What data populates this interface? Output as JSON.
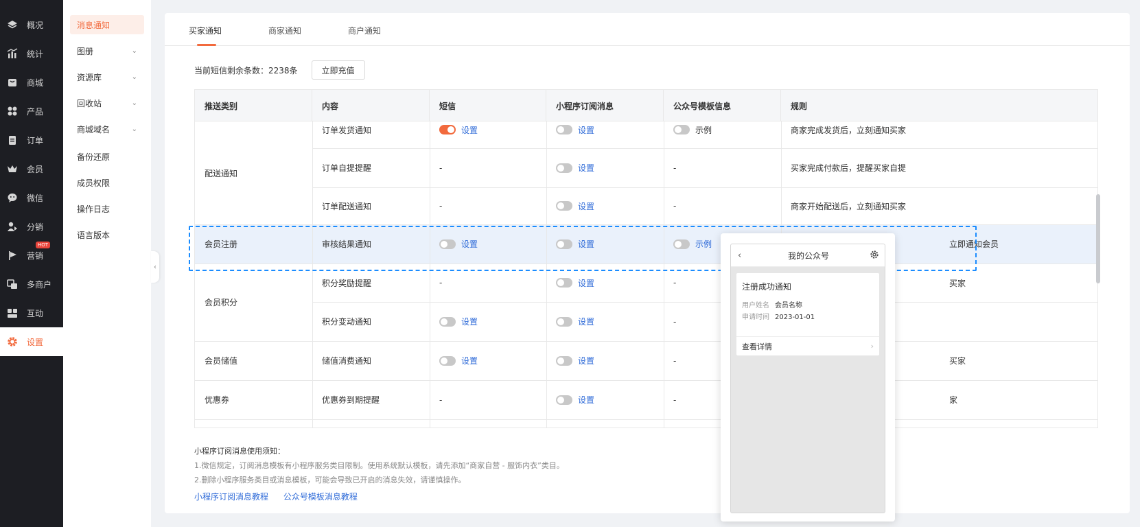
{
  "nav": {
    "items": [
      {
        "label": "概况",
        "icon": "layers-icon"
      },
      {
        "label": "统计",
        "icon": "chart-icon"
      },
      {
        "label": "商城",
        "icon": "shop-icon"
      },
      {
        "label": "产品",
        "icon": "product-icon"
      },
      {
        "label": "订单",
        "icon": "order-icon"
      },
      {
        "label": "会员",
        "icon": "crown-icon"
      },
      {
        "label": "微信",
        "icon": "wechat-icon"
      },
      {
        "label": "分销",
        "icon": "distribution-icon"
      },
      {
        "label": "营销",
        "icon": "flag-icon",
        "badge": "HOT"
      },
      {
        "label": "多商户",
        "icon": "merchant-icon"
      },
      {
        "label": "互动",
        "icon": "interact-icon"
      },
      {
        "label": "设置",
        "icon": "gear-icon",
        "active": true
      }
    ]
  },
  "submenu": {
    "items": [
      {
        "label": "消息通知",
        "active": true
      },
      {
        "label": "图册",
        "expandable": true
      },
      {
        "label": "资源库",
        "expandable": true
      },
      {
        "label": "回收站",
        "expandable": true
      },
      {
        "label": "商城域名",
        "expandable": true
      },
      {
        "label": "备份还原"
      },
      {
        "label": "成员权限"
      },
      {
        "label": "操作日志"
      },
      {
        "label": "语言版本"
      }
    ]
  },
  "tabs": [
    {
      "label": "买家通知",
      "active": true
    },
    {
      "label": "商家通知"
    },
    {
      "label": "商户通知"
    }
  ],
  "sms": {
    "remaining_label": "当前短信剩余条数：2238条",
    "recharge_button": "立即充值"
  },
  "table": {
    "headers": [
      "推送类别",
      "内容",
      "短信",
      "小程序订阅消息",
      "公众号模板信息",
      "规则"
    ],
    "groups": [
      "配送通知",
      "会员注册",
      "会员积分",
      "会员储值",
      "优惠券"
    ],
    "rows": [
      {
        "content": "订单发货通知",
        "sms": {
          "toggle": "on",
          "text": "设置"
        },
        "mini": {
          "toggle": "off",
          "text": "设置"
        },
        "mp": {
          "toggle": "off",
          "text": "示例"
        },
        "rule": "商家完成发货后，立刻通知买家"
      },
      {
        "content": "订单自提提醒",
        "sms": {
          "text": "-"
        },
        "mini": {
          "toggle": "off",
          "text": "设置"
        },
        "mp": {
          "text": "-"
        },
        "rule": "买家完成付款后，提醒买家自提"
      },
      {
        "content": "订单配送通知",
        "sms": {
          "text": "-"
        },
        "mini": {
          "toggle": "off",
          "text": "设置"
        },
        "mp": {
          "text": "-"
        },
        "rule": "商家开始配送后，立刻通知买家"
      },
      {
        "content": "审核结果通知",
        "sms": {
          "toggle": "off",
          "text": "设置"
        },
        "mini": {
          "toggle": "off",
          "text": "设置"
        },
        "mp": {
          "toggle": "off",
          "text": "示例"
        },
        "rule": "立即通知会员"
      },
      {
        "content": "积分奖励提醒",
        "sms": {
          "text": "-"
        },
        "mini": {
          "toggle": "off",
          "text": "设置"
        },
        "mp": {
          "text": "-"
        },
        "rule": "买家"
      },
      {
        "content": "积分变动通知",
        "sms": {
          "toggle": "off",
          "text": "设置"
        },
        "mini": {
          "toggle": "off",
          "text": "设置"
        },
        "mp": {
          "text": "-"
        },
        "rule": ""
      },
      {
        "content": "储值消费通知",
        "sms": {
          "toggle": "off",
          "text": "设置"
        },
        "mini": {
          "toggle": "off",
          "text": "设置"
        },
        "mp": {
          "text": "-"
        },
        "rule": "买家"
      },
      {
        "content": "优惠券到期提醒",
        "sms": {
          "text": "-"
        },
        "mini": {
          "toggle": "off",
          "text": "设置"
        },
        "mp": {
          "text": "-"
        },
        "rule": "家"
      }
    ]
  },
  "notes": {
    "title": "小程序订阅消息使用须知：",
    "line1": "1.微信规定，订阅消息模板有小程序服务类目限制。使用系统默认模板，请先添加“商家自营 - 服饰内衣”类目。",
    "line2": "2.删除小程序服务类目或消息模板，可能会导致已开启的消息失效，请谨慎操作。",
    "link1": "小程序订阅消息教程",
    "link2": "公众号模板消息教程"
  },
  "preview": {
    "header": "我的公众号",
    "title": "注册成功通知",
    "k1": "用户姓名",
    "v1": "会员名称",
    "k2": "申请时间",
    "v2": "2023-01-01",
    "footer": "查看详情"
  },
  "colors": {
    "accent": "#f26a3d",
    "link": "#2f6bd8",
    "highlight": "#1a8cff"
  }
}
